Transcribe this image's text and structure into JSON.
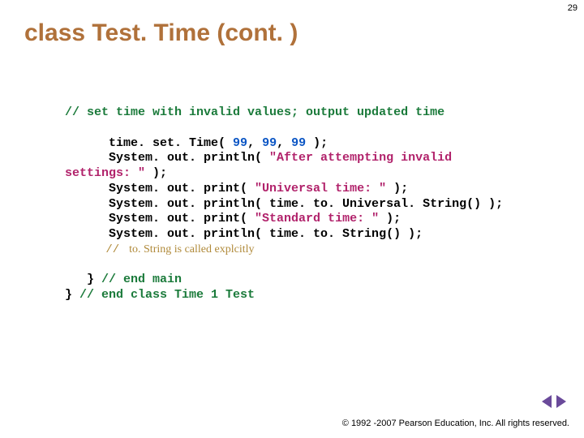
{
  "page_number": "29",
  "title": "class Test. Time (cont. )",
  "code": {
    "c1": "// set time with invalid values; output updated time",
    "l1a": "      time. set. Time( ",
    "n1": "99",
    "sep": ", ",
    "l1b": " );",
    "l2a": "      System. out. println( ",
    "s2": "\"After attempting invalid",
    "l3a": "settings: \"",
    "l3b": " );",
    "l4a": "      System. out. print( ",
    "s4": "\"Universal time: \"",
    "l4b": " );",
    "l5": "      System. out. println( time. to. Universal. String() );",
    "l6a": "      System. out. print( ",
    "s6": "\"Standard time: \"",
    "l6b": " );",
    "l7": "      System. out. println( time. to. String() );",
    "note_slashes": "      // ",
    "note_text": " to. String is called explcitly",
    "end1a": "   } ",
    "end1b": "// end main",
    "end2a": "} ",
    "end2b": "// end class Time 1 Test"
  },
  "footer": "© 1992 -2007 Pearson Education, Inc. All rights reserved."
}
